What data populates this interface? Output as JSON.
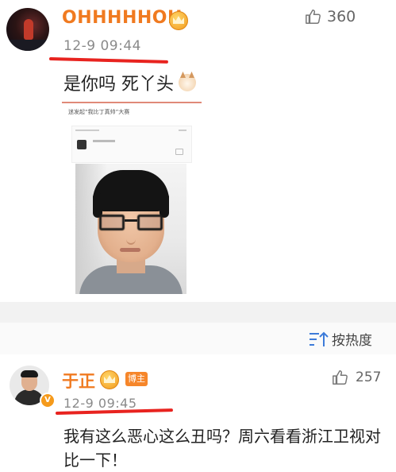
{
  "top_comment": {
    "username": "OHHHHHOH",
    "like_count": "360",
    "timestamp": "12-9 09:44",
    "text": "是你吗 死丫头",
    "embedded_image": {
      "header_text": "迷发起“我比丁真帅”大赛"
    }
  },
  "sort": {
    "label": "按热度"
  },
  "bottom_comment": {
    "username": "于正",
    "role_tag": "博主",
    "verified_mark": "V",
    "like_count": "257",
    "timestamp": "12-9 09:45",
    "text": "我有这么恶心这么丑吗？周六看看浙江卫视对比一下！"
  },
  "colors": {
    "username": "#f07a20",
    "highlight_underline": "#e8231f",
    "role_tag_bg": "#f6862a",
    "section_gap": "#f2f2f2"
  },
  "icons": {
    "like": "thumbs-up-icon",
    "sort": "sort-icon",
    "member_badge": "crown-badge-icon",
    "emoji": "cat-face-emoji"
  }
}
